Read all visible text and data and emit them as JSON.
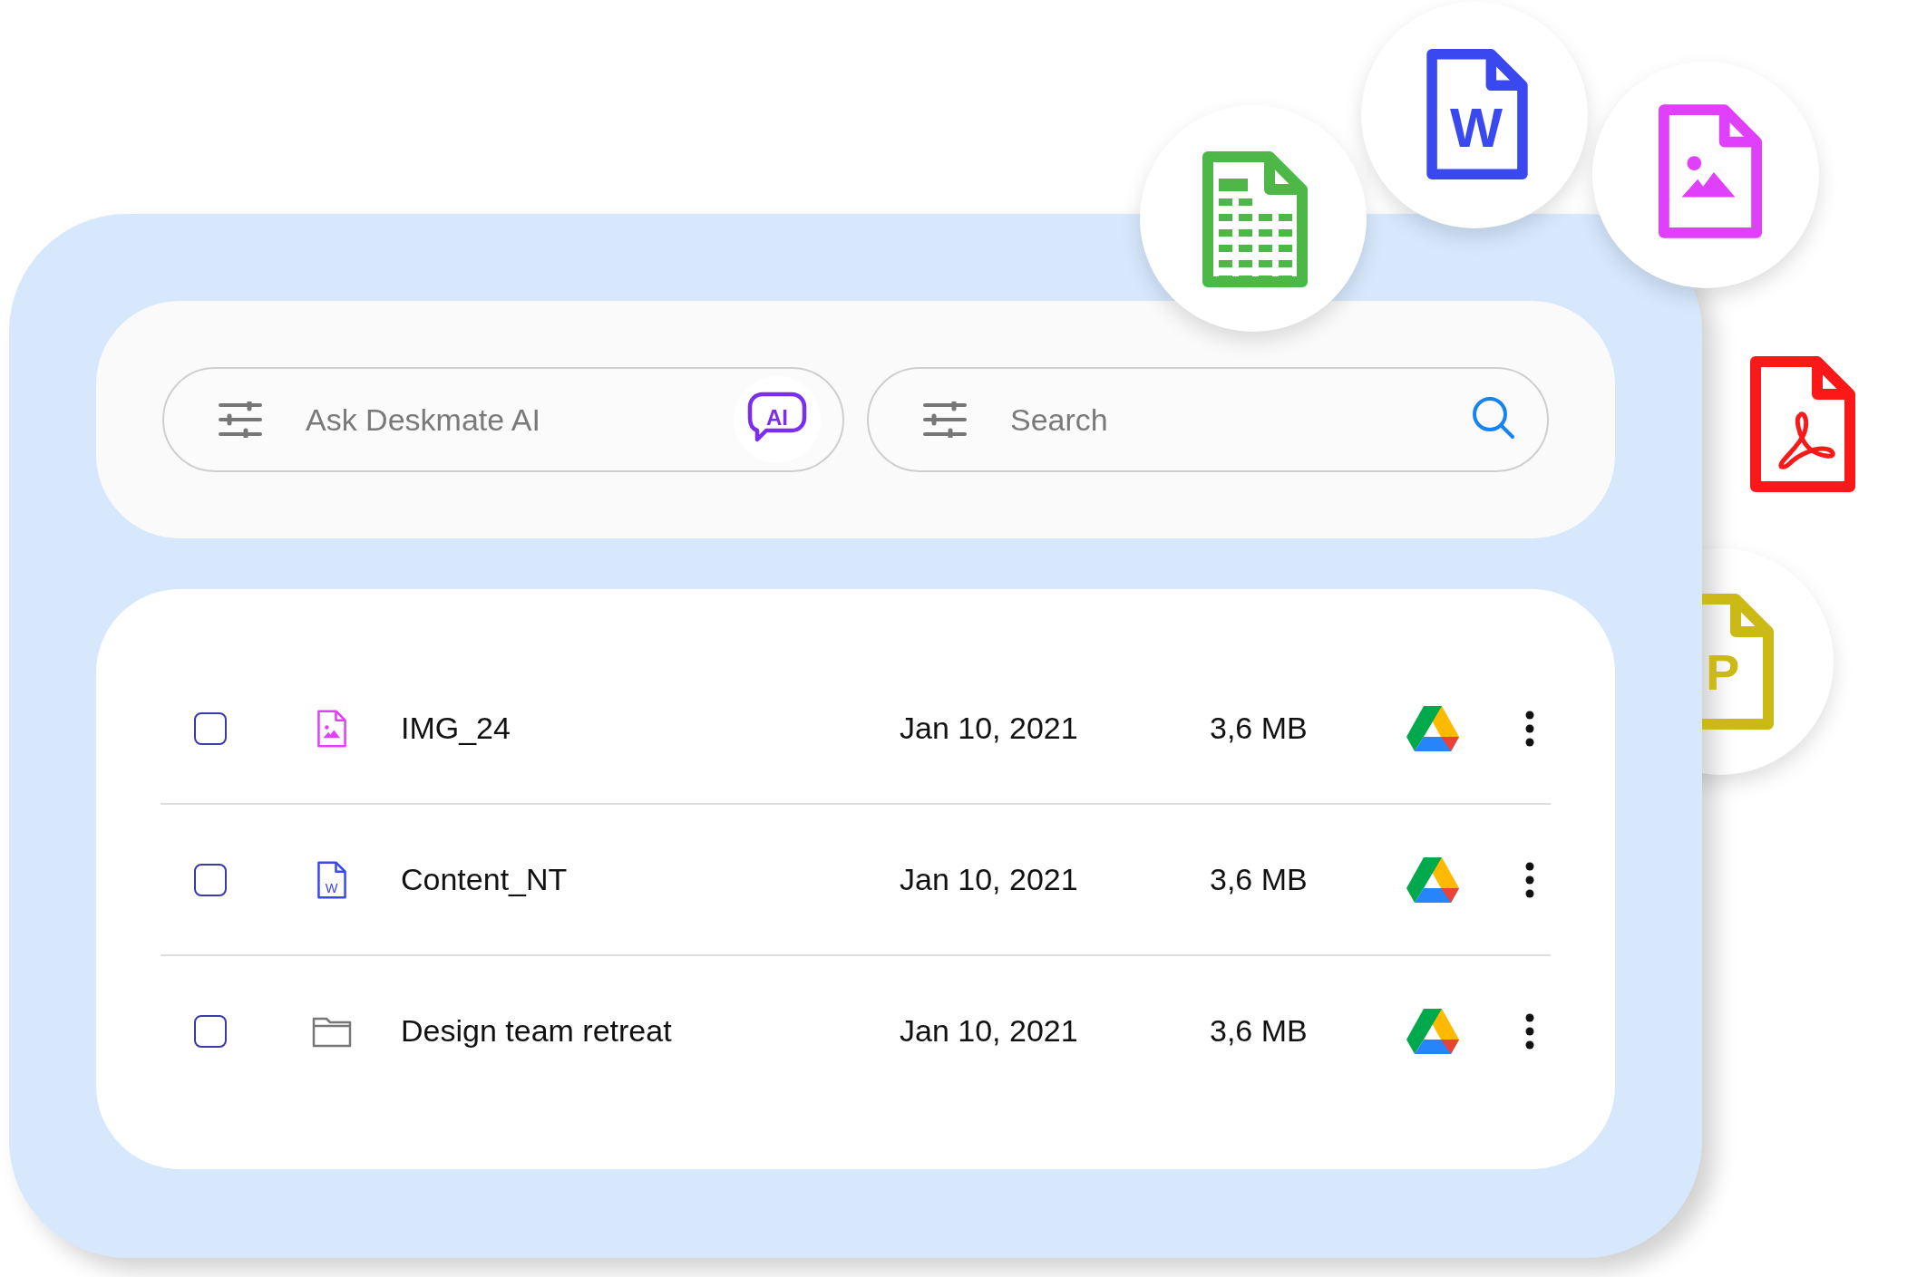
{
  "ai_field": {
    "placeholder": "Ask Deskmate AI",
    "badge": "AI"
  },
  "search_field": {
    "placeholder": "Search"
  },
  "files": [
    {
      "kind": "image",
      "name": "IMG_24",
      "date": "Jan 10, 2021",
      "size": "3,6 MB",
      "checked": false
    },
    {
      "kind": "word",
      "icon_letter": "W",
      "name": "Content_NT",
      "date": "Jan 10, 2021",
      "size": "3,6 MB",
      "checked": false
    },
    {
      "kind": "folder",
      "name": "Design team retreat",
      "date": "Jan 10, 2021",
      "size": "3,6 MB",
      "checked": false
    }
  ],
  "floating_icons": [
    {
      "kind": "slides",
      "letter": "P"
    },
    {
      "kind": "sheet"
    },
    {
      "kind": "word",
      "letter": "W"
    },
    {
      "kind": "image"
    },
    {
      "kind": "pdf"
    }
  ]
}
